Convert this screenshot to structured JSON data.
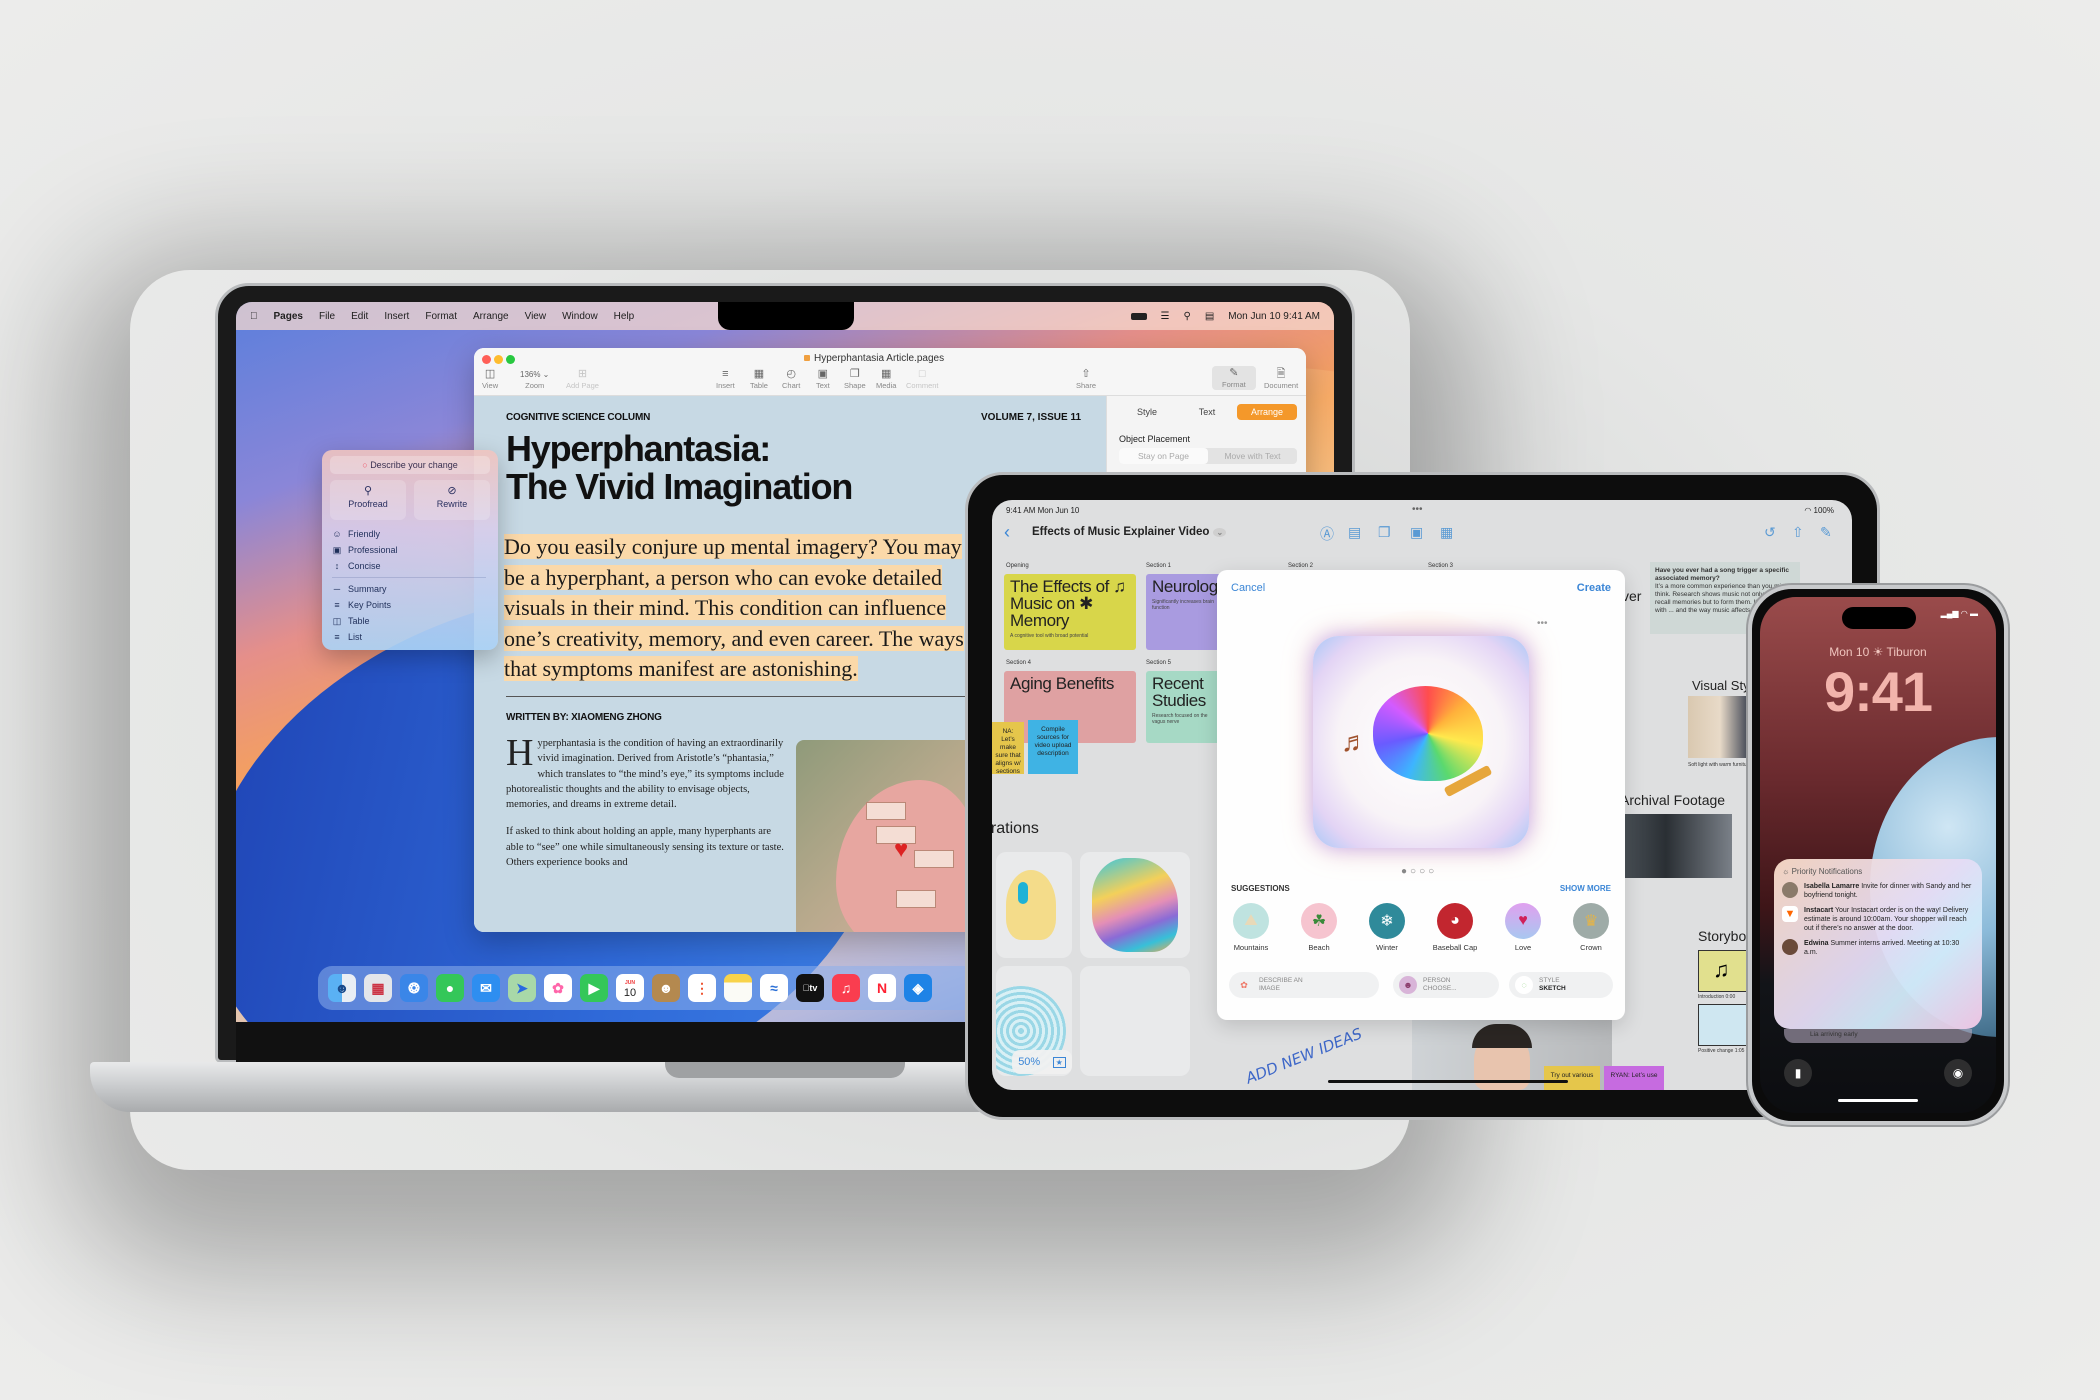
{
  "mac": {
    "menubar": {
      "apple": "",
      "app": "Pages",
      "items": [
        "File",
        "Edit",
        "Insert",
        "Format",
        "Arrange",
        "View",
        "Window",
        "Help"
      ],
      "datetime": "Mon Jun 10  9:41 AM"
    },
    "pages": {
      "doc_title": "Hyperphantasia Article.pages",
      "toolbar": {
        "view": "View",
        "zoom_value": "136% ⌄",
        "zoom": "Zoom",
        "add_page": "Add Page",
        "insert": "Insert",
        "table": "Table",
        "chart": "Chart",
        "text": "Text",
        "shape": "Shape",
        "media": "Media",
        "comment": "Comment",
        "share": "Share",
        "format": "Format",
        "document": "Document"
      },
      "article": {
        "kicker": "COGNITIVE SCIENCE COLUMN",
        "volume": "VOLUME 7, ISSUE 11",
        "headline_1": "Hyperphantasia:",
        "headline_2": "The Vivid Imagination",
        "lede_lines": [
          "Do you easily conjure up mental imagery? You may",
          "be a hyperphant, a person who can evoke detailed",
          "visuals in their mind. This condition can influence",
          "one’s creativity, memory, and even career. The ways",
          "that symptoms manifest are astonishing."
        ],
        "byline": "WRITTEN BY: XIAOMENG ZHONG",
        "dropcap": "H",
        "para1": "yperphantasia is the condition of having an extraordinarily vivid imagination. Derived from Aristotle’s “phantasia,” which translates to “the mind’s eye,” its symptoms include photorealistic thoughts and the ability to envisage objects, memories, and dreams in extreme detail.",
        "para2": "If asked to think about holding an apple, many hyperphants are able to “see” one while simultaneously sensing its texture or taste. Others experience books and"
      },
      "inspector": {
        "tabs": [
          "Style",
          "Text",
          "Arrange"
        ],
        "active_tab": "Arrange",
        "section_label": "Object Placement",
        "segments": [
          "Stay on Page",
          "Move with Text"
        ]
      }
    },
    "writing_tools": {
      "describe": "Describe your change",
      "proofread": "Proofread",
      "rewrite": "Rewrite",
      "tone_items": [
        "Friendly",
        "Professional",
        "Concise"
      ],
      "format_items": [
        "Summary",
        "Key Points",
        "Table",
        "List"
      ]
    },
    "dock": {
      "apps": [
        "Finder",
        "Launchpad",
        "Safari",
        "Messages",
        "Mail",
        "Maps",
        "Photos",
        "FaceTime",
        "Calendar",
        "Contacts",
        "Reminders",
        "Notes",
        "Freeform",
        "TV",
        "Music",
        "News",
        "Keynote"
      ],
      "calendar_month": "JUN",
      "calendar_day": "10",
      "tv_label": "tv"
    }
  },
  "ipad": {
    "status_time": "9:41 AM  Mon Jun 10",
    "status_battery": "◠ 100%",
    "board_title": "Effects of Music Explainer Video",
    "sections": {
      "opening": "Opening",
      "s1": "Section 1",
      "s2": "Section 2",
      "s3": "Section 3",
      "s4": "Section 4",
      "s5": "Section 5"
    },
    "cards": {
      "opening_title": "The Effects of ♫ Music on ✱ Memory",
      "opening_sub": "A cognitive tool with broad potential",
      "s1_title": "Neurological Connections",
      "s1_sub": "Significantly increases brain function",
      "s4_title": "Aging Benefits",
      "s5_title": "Recent Studies",
      "s5_sub": "Research focused on the vagus nerve"
    },
    "stickies": {
      "yellow": "NA: Let’s make sure that aligns w/ sections",
      "blue": "Compile sources for video upload description",
      "bottom_yellow": "Try out various",
      "bottom_purple": "RYAN: Let’s use"
    },
    "right_note": {
      "title": "Have you ever had a song trigger a specific associated memory?",
      "body": "It’s a more common experience than you might think. Research shows music not only helps to recall memories but to form them. It all starts with ... and the way music affects the ..."
    },
    "headings": {
      "illustrations": "Illustrations",
      "visual_style": "Visual Style",
      "visual_caption": "Soft light with warm furniture",
      "archival": "Archival Footage",
      "storyboard": "Storyboard",
      "cover_partial": "ver"
    },
    "storyboard_captions": [
      "Introduction 0:00",
      "Positive change 1:05"
    ],
    "zoom_level": "50%",
    "handwriting": "ADD NEW IDEAS",
    "playground": {
      "cancel": "Cancel",
      "create": "Create",
      "more": "•••",
      "pager": "●○○○",
      "page_index": 1,
      "page_count": 4,
      "suggestions_label": "SUGGESTIONS",
      "show_more": "SHOW MORE",
      "suggestions": [
        {
          "label": "Mountains",
          "icon": "⛰",
          "color": "#bfe3e0"
        },
        {
          "label": "Beach",
          "icon": "🌴",
          "color": "#f6c4cf"
        },
        {
          "label": "Winter",
          "icon": "❄",
          "color": "#2f8a9a"
        },
        {
          "label": "Baseball Cap",
          "icon": "🧢",
          "color": "#c2262f"
        },
        {
          "label": "Love",
          "icon": "♥",
          "color": "#d8a8ee"
        },
        {
          "label": "Crown",
          "icon": "♛",
          "color": "#9eaba7"
        }
      ],
      "chips": [
        {
          "line1": "DESCRIBE AN",
          "line2": "IMAGE"
        },
        {
          "line1": "PERSON",
          "line2": "CHOOSE..."
        },
        {
          "line1": "STYLE",
          "line2": "SKETCH"
        }
      ]
    }
  },
  "iphone": {
    "status": "▂▄▆ ◠ ▬",
    "date": "Mon 10  ☀ Tiburon",
    "time": "9:41",
    "notifications": {
      "header": "Priority Notifications",
      "items": [
        {
          "sender": "Isabella Lamarre",
          "text": "Invite for dinner with Sandy and her boyfriend tonight."
        },
        {
          "sender": "Instacart",
          "text": "Your Instacart order is on the way! Delivery estimate is around 10:00am. Your shopper will reach out if there’s no answer at the door."
        },
        {
          "sender": "Edwina",
          "text": "Summer interns arrived. Meeting at 10:30 a.m."
        }
      ],
      "underneath": "Lia arriving early"
    }
  }
}
